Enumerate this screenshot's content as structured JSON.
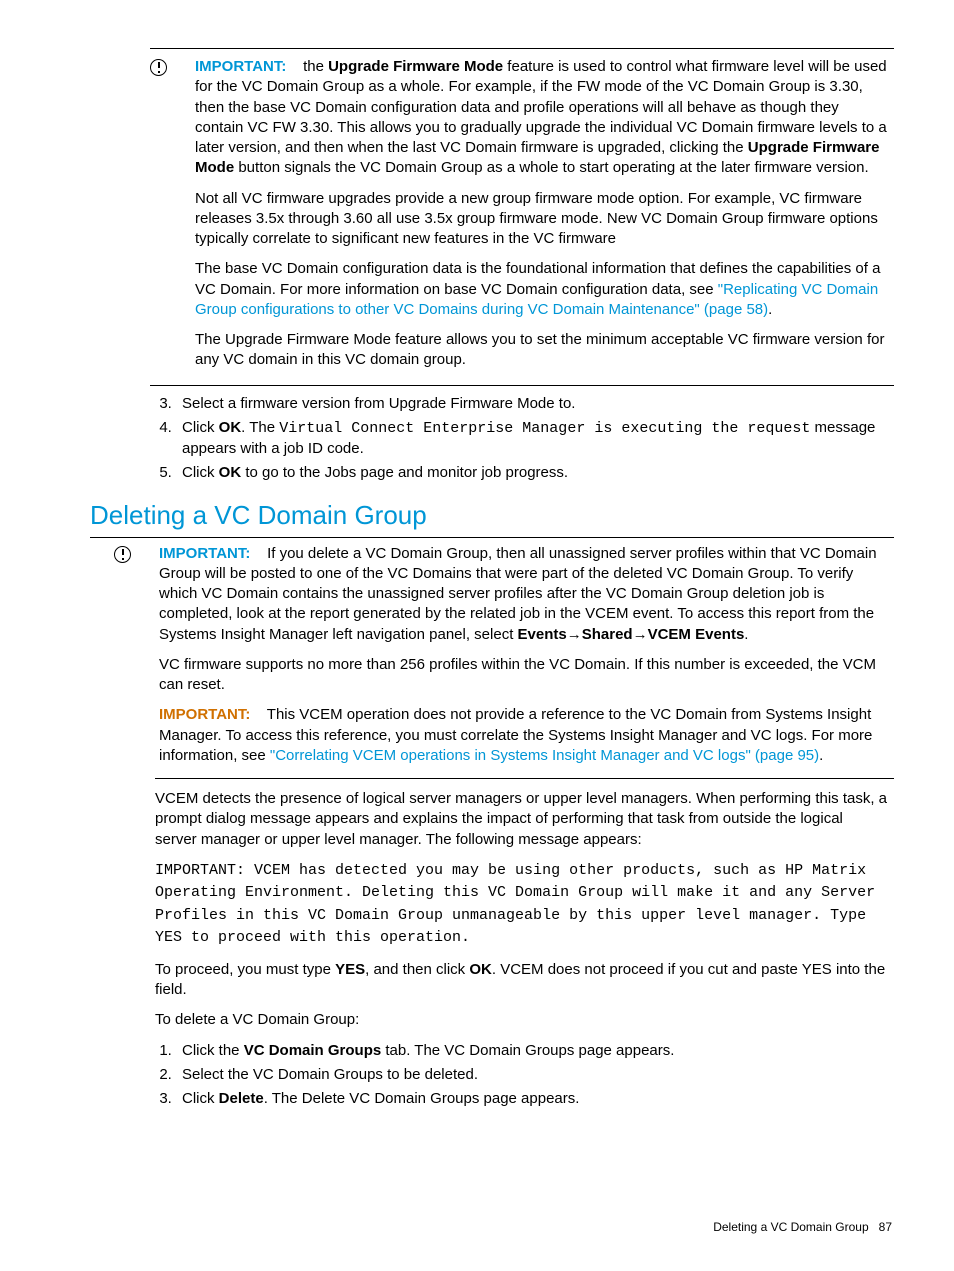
{
  "block1": {
    "important": "IMPORTANT:",
    "p1a": "the ",
    "p1b": "Upgrade Firmware Mode",
    "p1c": " feature is used to control what firmware level will be used for the VC Domain Group as a whole. For example, if the FW mode of the VC Domain Group is 3.30, then the base VC Domain configuration data and profile operations will all behave as though they contain VC FW 3.30. This allows you to gradually upgrade the individual VC Domain firmware levels to a later version, and then when the last VC Domain firmware is upgraded, clicking the ",
    "p1d": "Upgrade Firmware Mode",
    "p1e": " button signals the VC Domain Group as a whole to start operating at the later firmware version.",
    "p2": "Not all VC firmware upgrades provide a new group firmware mode option. For example, VC firmware releases 3.5x through 3.60 all use 3.5x  group firmware mode. New VC Domain Group firmware options typically correlate to significant new features in the VC firmware",
    "p3a": "The base VC Domain configuration data is the foundational information that defines the capabilities of a VC Domain. For more information on base VC Domain configuration data, see ",
    "p3link": "\"Replicating VC Domain Group configurations to other VC Domains during VC Domain Maintenance\" (page 58)",
    "p3b": ".",
    "p4": "The Upgrade Firmware Mode feature allows you to set the minimum acceptable VC firmware version for any VC domain in this VC domain group."
  },
  "list1": {
    "li3": "Select a firmware version from Upgrade Firmware Mode to.",
    "li4a": "Click ",
    "li4b": "OK",
    "li4c": ". The ",
    "li4mono": "Virtual Connect Enterprise Manager is executing the request",
    "li4d": " message appears with a job ID code.",
    "li5a": "Click ",
    "li5b": "OK",
    "li5c": " to go to the Jobs page and monitor job progress."
  },
  "heading": "Deleting a VC Domain Group",
  "block2": {
    "important": "IMPORTANT:",
    "p1a": "If you delete a VC Domain Group, then all unassigned server profiles within that VC Domain Group will be posted to one of the VC Domains that were part of the deleted VC Domain Group. To verify which VC Domain contains the unassigned server profiles after the VC Domain Group deletion job is completed, look at the report generated by the related job in the VCEM event. To access this report from the Systems Insight Manager left navigation panel, select ",
    "p1b": "Events",
    "arrow1": "→",
    "p1c": "Shared",
    "arrow2": "→",
    "p1d": "VCEM Events",
    "p1e": ".",
    "p2": "VC firmware supports no more than 256 profiles within the VC Domain. If this number is exceeded, the VCM can reset.",
    "p3imp": "IMPORTANT:",
    "p3a": "This VCEM operation does not provide a reference to the VC Domain from Systems Insight Manager. To access this reference, you must correlate the Systems Insight Manager and VC logs. For more information, see ",
    "p3link": "\"Correlating VCEM operations in Systems Insight Manager and VC logs\" (page 95)",
    "p3b": "."
  },
  "body2": {
    "p1": "VCEM detects the presence of logical server managers or upper level managers. When performing this task, a prompt dialog message appears and explains the impact of performing that task from outside the logical server manager or upper level manager. The following message appears:",
    "mono": "IMPORTANT: VCEM has detected you may be using other products, such as HP Matrix Operating Environment. Deleting this VC Domain Group will make it and any Server Profiles in this VC Domain Group unmanageable by this upper level manager. Type YES to proceed with this operation.",
    "p2a": "To proceed, you must type ",
    "p2b": "YES",
    "p2c": ", and then click ",
    "p2d": "OK",
    "p2e": ". VCEM does not proceed if you cut and paste YES into the field.",
    "p3": "To delete a VC Domain Group:"
  },
  "list2": {
    "li1a": "Click the ",
    "li1b": "VC Domain Groups",
    "li1c": " tab. The VC Domain Groups page appears.",
    "li2": "Select the VC Domain Groups to be deleted.",
    "li3a": "Click ",
    "li3b": "Delete",
    "li3c": ". The Delete VC Domain Groups page appears."
  },
  "footer": {
    "text": "Deleting a VC Domain Group",
    "page": "87"
  }
}
